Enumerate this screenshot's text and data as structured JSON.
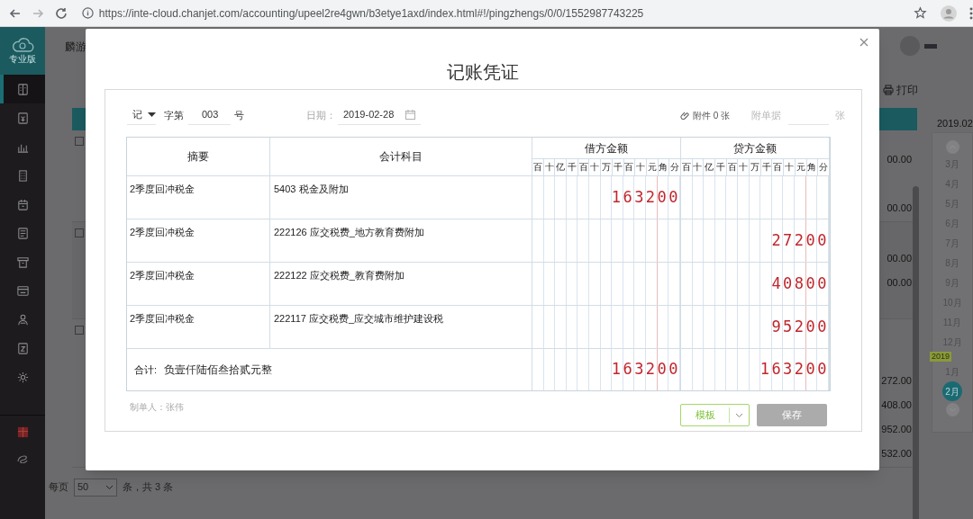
{
  "browser": {
    "url": "https://inte-cloud.chanjet.com/accounting/upeel2re4gwn/b3etye1axd/index.html#!/pingzhengs/0/0/1552987743225"
  },
  "sidebar": {
    "edition": "专业版",
    "items": [
      {
        "selected": true
      },
      {
        "selected": false
      },
      {
        "selected": false
      },
      {
        "selected": false
      },
      {
        "selected": false
      },
      {
        "selected": false
      },
      {
        "selected": false
      },
      {
        "selected": false
      },
      {
        "selected": false
      },
      {
        "selected": false
      },
      {
        "selected": false
      }
    ]
  },
  "page": {
    "company": "麟游",
    "print": "打印",
    "groups": [
      {
        "checked": false,
        "amounts": [
          "00.00",
          "00.00"
        ]
      },
      {
        "checked": false,
        "amounts": [
          "00.00",
          "00.00"
        ]
      },
      {
        "checked": false,
        "amounts": [
          "272.00",
          "408.00",
          "952.00",
          "532.00"
        ]
      }
    ],
    "pager": {
      "label": "每页",
      "size": "50",
      "summary": "条，共 3 条"
    }
  },
  "calendar": {
    "current": "2019.02",
    "months": [
      {
        "label": "3月",
        "selected": false
      },
      {
        "label": "4月",
        "selected": false
      },
      {
        "label": "5月",
        "selected": false
      },
      {
        "label": "6月",
        "selected": false
      },
      {
        "label": "7月",
        "selected": false
      },
      {
        "label": "8月",
        "selected": false
      },
      {
        "label": "9月",
        "selected": false
      },
      {
        "label": "10月",
        "selected": false
      },
      {
        "label": "11月",
        "selected": false
      },
      {
        "label": "12月",
        "selected": false
      },
      {
        "label": "1月",
        "selected": false,
        "year_tag": "2019"
      },
      {
        "label": "2月",
        "selected": true
      }
    ]
  },
  "voucher": {
    "title": "记账凭证",
    "word": "记",
    "word_label": "字第",
    "number": "003",
    "number_suffix": "号",
    "date_label": "日期：",
    "date": "2019-02-28",
    "attachments": "附件 0 张",
    "docs_label": "附单据",
    "docs_unit": "张",
    "table": {
      "summary": "摘要",
      "account": "会计科目",
      "debit": "借方金额",
      "credit": "贷方金额",
      "debit_units": [
        "百",
        "十",
        "亿",
        "千",
        "百",
        "十",
        "万",
        "千",
        "百",
        "十",
        "元",
        "角",
        "分"
      ],
      "credit_units": [
        "百",
        "十",
        "亿",
        "千",
        "百",
        "十",
        "万",
        "千",
        "百",
        "十",
        "元",
        "角",
        "分"
      ]
    },
    "entries": [
      {
        "summary": "2季度回冲税金",
        "account": "5403 税金及附加",
        "debit": "163200"
      },
      {
        "summary": "2季度回冲税金",
        "account": "222126 应交税费_地方教育费附加",
        "credit": "27200"
      },
      {
        "summary": "2季度回冲税金",
        "account": "222122 应交税费_教育费附加",
        "credit": "40800"
      },
      {
        "summary": "2季度回冲税金",
        "account": "222117 应交税费_应交城市维护建设税",
        "credit": "95200"
      }
    ],
    "total": {
      "label": "合计:",
      "in_words": "负壹仟陆佰叁拾贰元整",
      "debit": "163200",
      "credit": "163200"
    },
    "preparer": "制单人：张伟",
    "template_button": "模板",
    "save": {
      "label": "保存",
      "disabled": true
    }
  }
}
